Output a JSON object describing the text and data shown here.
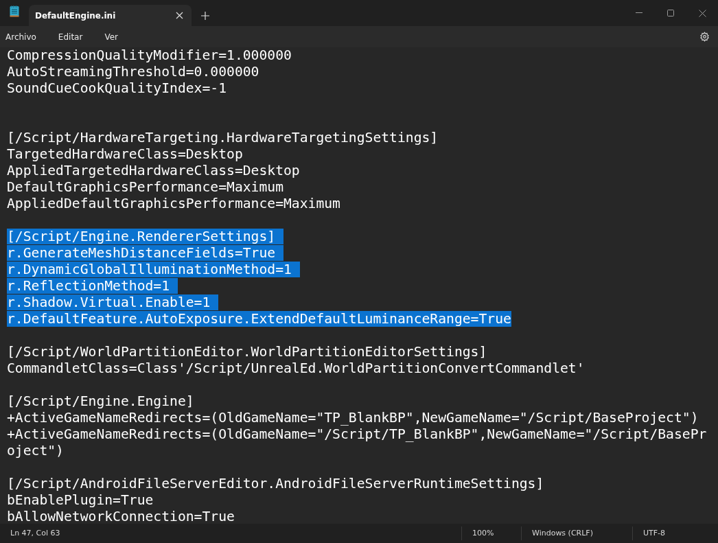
{
  "tabs": [
    {
      "label": "DefaultEngine.ini"
    }
  ],
  "menu": [
    "Archivo",
    "Editar",
    "Ver"
  ],
  "lines": [
    {
      "kind": "text",
      "text": "CompressionQualityModifier=1.000000",
      "selected": false
    },
    {
      "kind": "text",
      "text": "AutoStreamingThreshold=0.000000",
      "selected": false
    },
    {
      "kind": "text",
      "text": "SoundCueCookQualityIndex=-1",
      "selected": false
    },
    {
      "kind": "blank"
    },
    {
      "kind": "blank"
    },
    {
      "kind": "text",
      "text": "[/Script/HardwareTargeting.HardwareTargetingSettings]",
      "selected": false
    },
    {
      "kind": "text",
      "text": "TargetedHardwareClass=Desktop",
      "selected": false
    },
    {
      "kind": "text",
      "text": "AppliedTargetedHardwareClass=Desktop",
      "selected": false
    },
    {
      "kind": "text",
      "text": "DefaultGraphicsPerformance=Maximum",
      "selected": false
    },
    {
      "kind": "text",
      "text": "AppliedDefaultGraphicsPerformance=Maximum",
      "selected": false
    },
    {
      "kind": "blank"
    },
    {
      "kind": "text",
      "text": "[/Script/Engine.RendererSettings]",
      "selected": true
    },
    {
      "kind": "text",
      "text": "r.GenerateMeshDistanceFields=True",
      "selected": true
    },
    {
      "kind": "text",
      "text": "r.DynamicGlobalIlluminationMethod=1",
      "selected": true
    },
    {
      "kind": "text",
      "text": "r.ReflectionMethod=1",
      "selected": true
    },
    {
      "kind": "text",
      "text": "r.Shadow.Virtual.Enable=1",
      "selected": true
    },
    {
      "kind": "text",
      "text": "r.DefaultFeature.AutoExposure.ExtendDefaultLuminanceRange=True",
      "selected": true
    },
    {
      "kind": "blank"
    },
    {
      "kind": "text",
      "text": "[/Script/WorldPartitionEditor.WorldPartitionEditorSettings]",
      "selected": false
    },
    {
      "kind": "text",
      "text": "CommandletClass=Class'/Script/UnrealEd.WorldPartitionConvertCommandlet'",
      "selected": false
    },
    {
      "kind": "blank"
    },
    {
      "kind": "text",
      "text": "[/Script/Engine.Engine]",
      "selected": false
    },
    {
      "kind": "text",
      "text": "+ActiveGameNameRedirects=(OldGameName=\"TP_BlankBP\",NewGameName=\"/Script/BaseProject\")",
      "selected": false
    },
    {
      "kind": "text",
      "text": "+ActiveGameNameRedirects=(OldGameName=\"/Script/TP_BlankBP\",NewGameName=\"/Script/BaseProject\")",
      "selected": false
    },
    {
      "kind": "blank"
    },
    {
      "kind": "text",
      "text": "[/Script/AndroidFileServerEditor.AndroidFileServerRuntimeSettings]",
      "selected": false
    },
    {
      "kind": "text",
      "text": "bEnablePlugin=True",
      "selected": false
    },
    {
      "kind": "text",
      "text": "bAllowNetworkConnection=True",
      "selected": false
    }
  ],
  "status_bar": {
    "position": "Ln 47, Col 63",
    "zoom": "100%",
    "line_ending": "Windows (CRLF)",
    "encoding": "UTF-8"
  }
}
